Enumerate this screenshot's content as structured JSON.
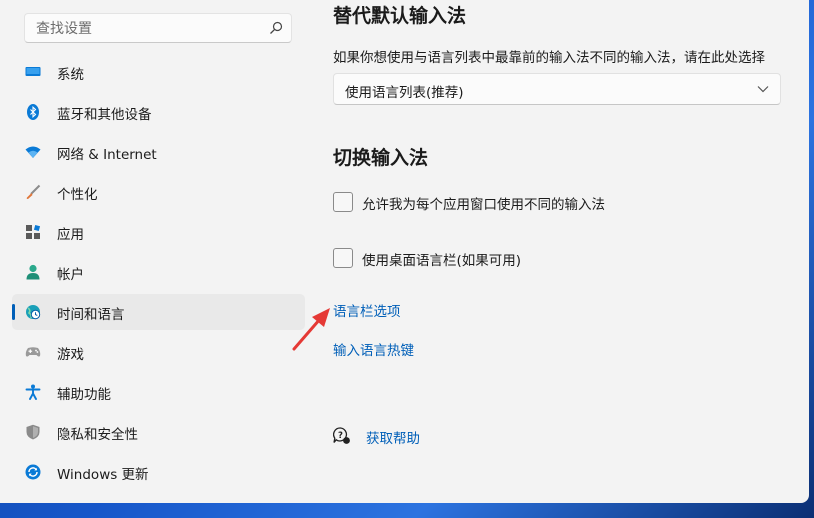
{
  "search": {
    "placeholder": "查找设置",
    "icon": "search-icon"
  },
  "sidebar": {
    "items": [
      {
        "label": "系统",
        "icon": "system-display-icon",
        "color": "#0078d4"
      },
      {
        "label": "蓝牙和其他设备",
        "icon": "bluetooth-icon",
        "color": "#0078d4"
      },
      {
        "label": "网络 & Internet",
        "icon": "wifi-icon",
        "color": "#0078d4"
      },
      {
        "label": "个性化",
        "icon": "brush-icon",
        "color": "#e0763a"
      },
      {
        "label": "应用",
        "icon": "apps-icon",
        "color": "#5a5a5a"
      },
      {
        "label": "帐户",
        "icon": "person-icon",
        "color": "#2ba98c"
      },
      {
        "label": "时间和语言",
        "icon": "globe-clock-icon",
        "color": "#0078d4",
        "active": true
      },
      {
        "label": "游戏",
        "icon": "gamepad-icon",
        "color": "#8a8a8a"
      },
      {
        "label": "辅助功能",
        "icon": "accessibility-icon",
        "color": "#0078d4"
      },
      {
        "label": "隐私和安全性",
        "icon": "shield-icon",
        "color": "#7a7a7a"
      },
      {
        "label": "Windows 更新",
        "icon": "windows-update-icon",
        "color": "#0078d4"
      }
    ]
  },
  "content": {
    "override_title": "替代默认输入法",
    "override_desc": "如果你想使用与语言列表中最靠前的输入法不同的输入法，请在此处选择",
    "override_select_value": "使用语言列表(推荐)",
    "switch_title": "切换输入法",
    "checkbox_per_app": {
      "label": "允许我为每个应用窗口使用不同的输入法",
      "checked": false
    },
    "checkbox_langbar": {
      "label": "使用桌面语言栏(如果可用)",
      "checked": false
    },
    "link_langbar_options": "语言栏选项",
    "link_hotkeys": "输入语言热键",
    "help_link": "获取帮助",
    "help_icon": "help-chat-icon"
  },
  "colors": {
    "accent": "#005fb8",
    "annotation_arrow": "#e53935"
  }
}
